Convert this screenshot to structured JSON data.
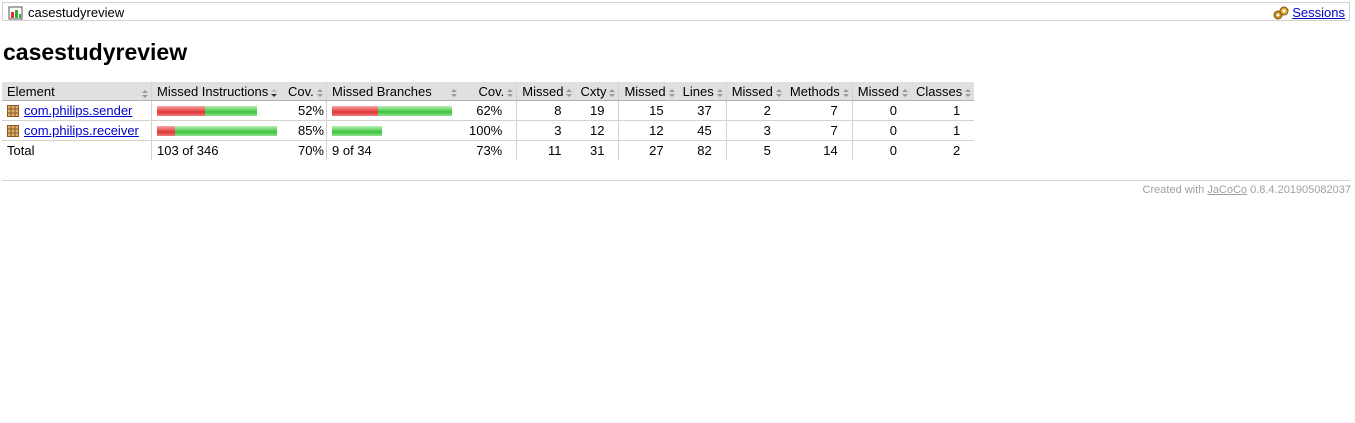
{
  "breadcrumb": {
    "label": "casestudyreview",
    "sessions_link": "Sessions"
  },
  "page": {
    "title": "casestudyreview"
  },
  "table": {
    "headers": {
      "element": "Element",
      "missed_instructions": "Missed Instructions",
      "cov_instructions": "Cov.",
      "missed_branches": "Missed Branches",
      "cov_branches": "Cov.",
      "missed_cxty": "Missed",
      "cxty": "Cxty",
      "missed_lines": "Missed",
      "lines": "Lines",
      "missed_methods": "Missed",
      "methods": "Methods",
      "missed_classes": "Missed",
      "classes": "Classes"
    },
    "rows": [
      {
        "name": "com.philips.sender",
        "instr_missed_fraction": 0.48,
        "cov_instructions": "52%",
        "branch_missed_fraction": 0.38,
        "cov_branches": "62%",
        "missed_cxty": "8",
        "cxty": "19",
        "missed_lines": "15",
        "lines": "37",
        "missed_methods": "2",
        "methods": "7",
        "missed_classes": "0",
        "classes": "1"
      },
      {
        "name": "com.philips.receiver",
        "instr_missed_fraction": 0.15,
        "cov_instructions": "85%",
        "branch_missed_fraction": 0.0,
        "cov_branches": "100%",
        "missed_cxty": "3",
        "cxty": "12",
        "missed_lines": "12",
        "lines": "45",
        "missed_methods": "3",
        "methods": "7",
        "missed_classes": "0",
        "classes": "1"
      }
    ],
    "total": {
      "label": "Total",
      "missed_instructions": "103 of 346",
      "cov_instructions": "70%",
      "missed_branches": "9 of 34",
      "cov_branches": "73%",
      "missed_cxty": "11",
      "cxty": "31",
      "missed_lines": "27",
      "lines": "82",
      "missed_methods": "5",
      "methods": "14",
      "missed_classes": "0",
      "classes": "2"
    }
  },
  "footer": {
    "prefix": "Created with",
    "link": "JaCoCo",
    "version": "0.8.4.201905082037"
  },
  "colors": {
    "missed": "#e03434",
    "covered": "#3cc43c",
    "header_bg": "#e0e0e0",
    "link": "#0000cc"
  }
}
